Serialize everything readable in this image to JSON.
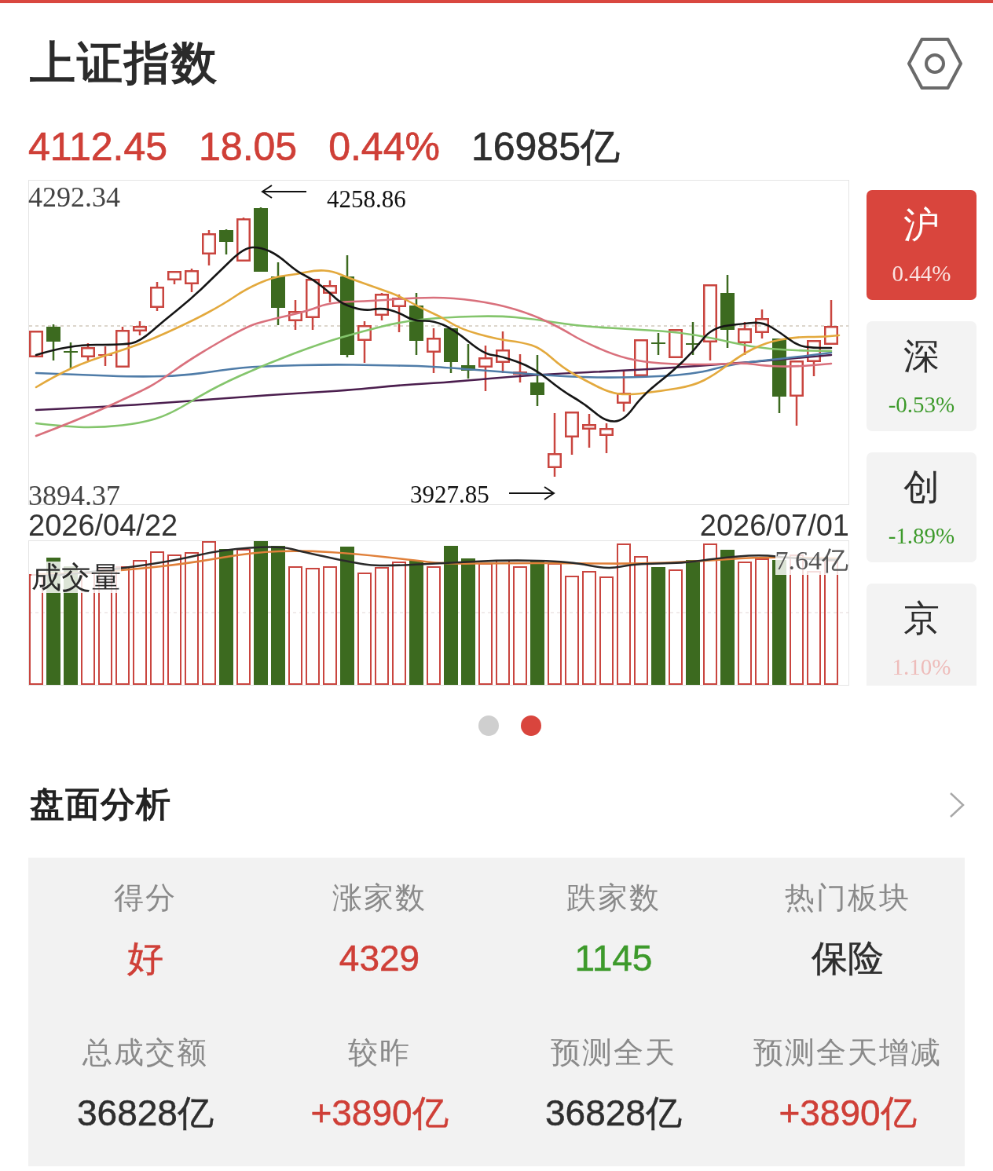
{
  "header": {
    "title": "上证指数"
  },
  "quote": [
    {
      "text": "4112.45",
      "color": "#cf3f37"
    },
    {
      "text": "18.05",
      "color": "#cf3f37"
    },
    {
      "text": "0.44%",
      "color": "#cf3f37"
    },
    {
      "text": "16985亿",
      "color": "#2e2e2e"
    }
  ],
  "kline": {
    "high_label": "4292.34",
    "low_label": "3894.37",
    "max_marker": "4258.86",
    "min_marker": "3927.85",
    "start_date": "2026/04/22",
    "end_date": "2026/07/01"
  },
  "volume": {
    "title": "成交量",
    "max_label": "7.64亿"
  },
  "market_tabs": [
    {
      "label": "沪",
      "change": "0.44%",
      "color": "#d9453d",
      "selected": true
    },
    {
      "label": "深",
      "change": "-0.53%",
      "color": "#3d9a2b",
      "selected": false
    },
    {
      "label": "创",
      "change": "-1.89%",
      "color": "#3d9a2b",
      "selected": false
    },
    {
      "label": "京",
      "change": "1.10%",
      "color": "#eebcba",
      "selected": false
    }
  ],
  "pager": [
    {
      "selected": false
    },
    {
      "selected": true
    }
  ],
  "analysis": {
    "title": "盘面分析",
    "stats": [
      {
        "label": "得分",
        "value": "好",
        "color": "#cf3f37"
      },
      {
        "label": "涨家数",
        "value": "4329",
        "color": "#cf3f37"
      },
      {
        "label": "跌家数",
        "value": "1145",
        "color": "#3d9a2b"
      },
      {
        "label": "热门板块",
        "value": "保险",
        "color": "#2e2e2e"
      },
      {
        "label": "总成交额",
        "value": "36828亿",
        "color": "#2e2e2e"
      },
      {
        "label": "较昨",
        "value": "+3890亿",
        "color": "#cf3f37"
      },
      {
        "label": "预测全天",
        "value": "36828亿",
        "color": "#2e2e2e"
      },
      {
        "label": "预测全天增减",
        "value": "+3890亿",
        "color": "#cf3f37"
      }
    ]
  }
}
